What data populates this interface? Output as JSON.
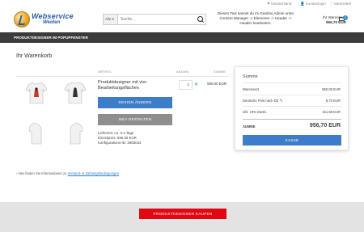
{
  "topbar": {
    "links": [
      "Deutschland",
      "Kundenlogin",
      "Merkzettel"
    ]
  },
  "logo": {
    "title": "Webservice",
    "subtitle": "Weiden"
  },
  "search": {
    "category": "Alle",
    "placeholder": "Suche..."
  },
  "header_text": "Diesen Text kannst du im Gambio Admin unter Content Manager -> Elemente -> Header -> Header bearbeiten.",
  "cart": {
    "label": "Ihr Warenkorb",
    "total": "956,70 EUR",
    "count": "1"
  },
  "navbar": {
    "item": "PRODUKTDESIGNER IM POPUPFENSTER"
  },
  "page_title": "Ihr Warenkorb",
  "table": {
    "headers": {
      "article": "ARTIKEL",
      "quantity": "ANZAHL",
      "sum": "SUMME"
    }
  },
  "item": {
    "name": "Produktdesigner mit vier Bearbeitungsflächen",
    "edit_button": "DESIGN ÄNDERN",
    "new_button": "NEU GESTALTEN",
    "delivery": "Lieferzeit: ca. 3-4 Tage",
    "unit_price": "Einzelpreis: 590,00 EUR",
    "config_id": "Konfigurations-ID: 2983034",
    "quantity": "1",
    "price": "590,00 EUR"
  },
  "summary": {
    "title": "Summe",
    "rows": [
      {
        "label": "Warenwert",
        "value": "950,00 EUR"
      },
      {
        "label": "Deutsche Post nach DE",
        "value": "6,70 EUR"
      },
      {
        "label": "inkl. 19% MwSt.",
        "value": "151,68 EUR"
      }
    ],
    "total_label": "SUMME",
    "total_value": "956,70 EUR",
    "checkout": "KASSE"
  },
  "info": {
    "text": "Hier finden Sie Informationen zu",
    "link": "Versand- & Zahlungsbedingungen"
  },
  "footer": {
    "buy_button": "PRODUKTDESIGNER KAUFEN"
  },
  "colors": {
    "accent": "#3d7cc9",
    "dark": "#3b3b3b",
    "buy": "#e30613"
  }
}
